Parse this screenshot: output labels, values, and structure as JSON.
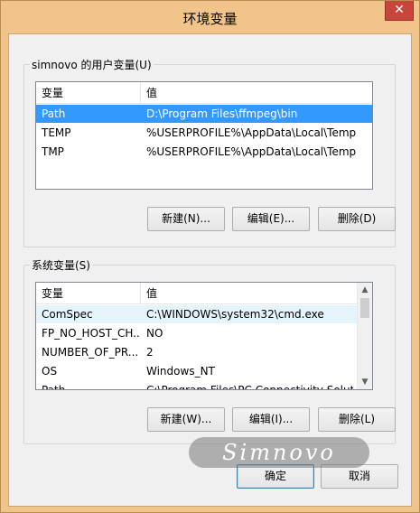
{
  "window": {
    "title": "环境变量",
    "close_glyph": "✕"
  },
  "user_vars": {
    "group_label": "simnovo 的用户变量(U)",
    "columns": [
      "变量",
      "值"
    ],
    "rows": [
      {
        "name": "Path",
        "value": "D:\\Program Files\\ffmpeg\\bin"
      },
      {
        "name": "TEMP",
        "value": "%USERPROFILE%\\AppData\\Local\\Temp"
      },
      {
        "name": "TMP",
        "value": "%USERPROFILE%\\AppData\\Local\\Temp"
      }
    ],
    "selected_index": 0,
    "buttons": {
      "new": "新建(N)...",
      "edit": "编辑(E)...",
      "delete": "删除(D)"
    }
  },
  "system_vars": {
    "group_label": "系统变量(S)",
    "columns": [
      "变量",
      "值"
    ],
    "rows": [
      {
        "name": "ComSpec",
        "value": "C:\\WINDOWS\\system32\\cmd.exe"
      },
      {
        "name": "FP_NO_HOST_CH...",
        "value": "NO"
      },
      {
        "name": "NUMBER_OF_PR...",
        "value": "2"
      },
      {
        "name": "OS",
        "value": "Windows_NT"
      },
      {
        "name": "Path",
        "value": "C:\\Program Files\\PC Connectivity Solutio"
      }
    ],
    "hover_index": 0,
    "buttons": {
      "new": "新建(W)...",
      "edit": "编辑(I)...",
      "delete": "删除(L)"
    }
  },
  "dialog_buttons": {
    "ok": "确定",
    "cancel": "取消"
  },
  "watermark": "Simnovo",
  "colors": {
    "frame": "#f0c48a",
    "selection": "#3399ff",
    "close": "#c7453a"
  }
}
